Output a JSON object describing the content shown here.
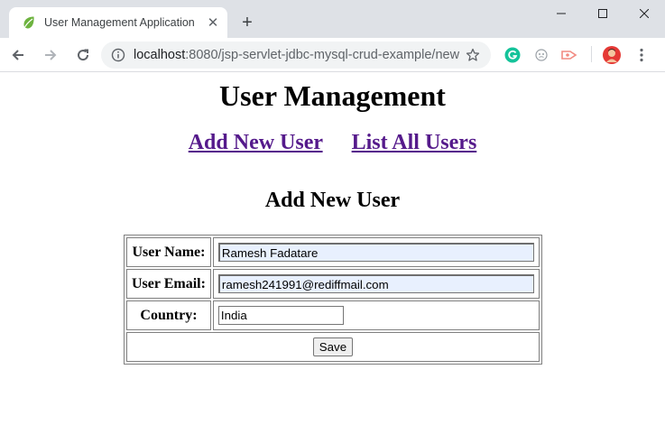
{
  "browser": {
    "tab_title": "User Management Application",
    "url_host": "localhost",
    "url_path": ":8080/jsp-servlet-jdbc-mysql-crud-example/new",
    "icons": {
      "favicon": "spring-leaf-icon",
      "tab_close": "close-icon",
      "new_tab": "plus-icon",
      "back": "back-arrow-icon",
      "forward": "forward-arrow-icon",
      "reload": "reload-icon",
      "site_info": "info-icon",
      "bookmark": "star-icon",
      "menu": "kebab-menu-icon"
    },
    "colors": {
      "tabstrip": "#dee1e6",
      "omnibox": "#f1f3f4"
    }
  },
  "page": {
    "title": "User Management",
    "links": [
      {
        "label": "Add New User"
      },
      {
        "label": "List All Users"
      }
    ],
    "form": {
      "heading": "Add New User",
      "fields": [
        {
          "label": "User Name:",
          "value": "Ramesh Fadatare"
        },
        {
          "label": "User Email:",
          "value": "ramesh241991@rediffmail.com"
        },
        {
          "label": "Country:",
          "value": "India"
        }
      ],
      "submit_label": "Save"
    },
    "colors": {
      "link": "#551a8b",
      "autofill": "#e8f0fe"
    }
  }
}
